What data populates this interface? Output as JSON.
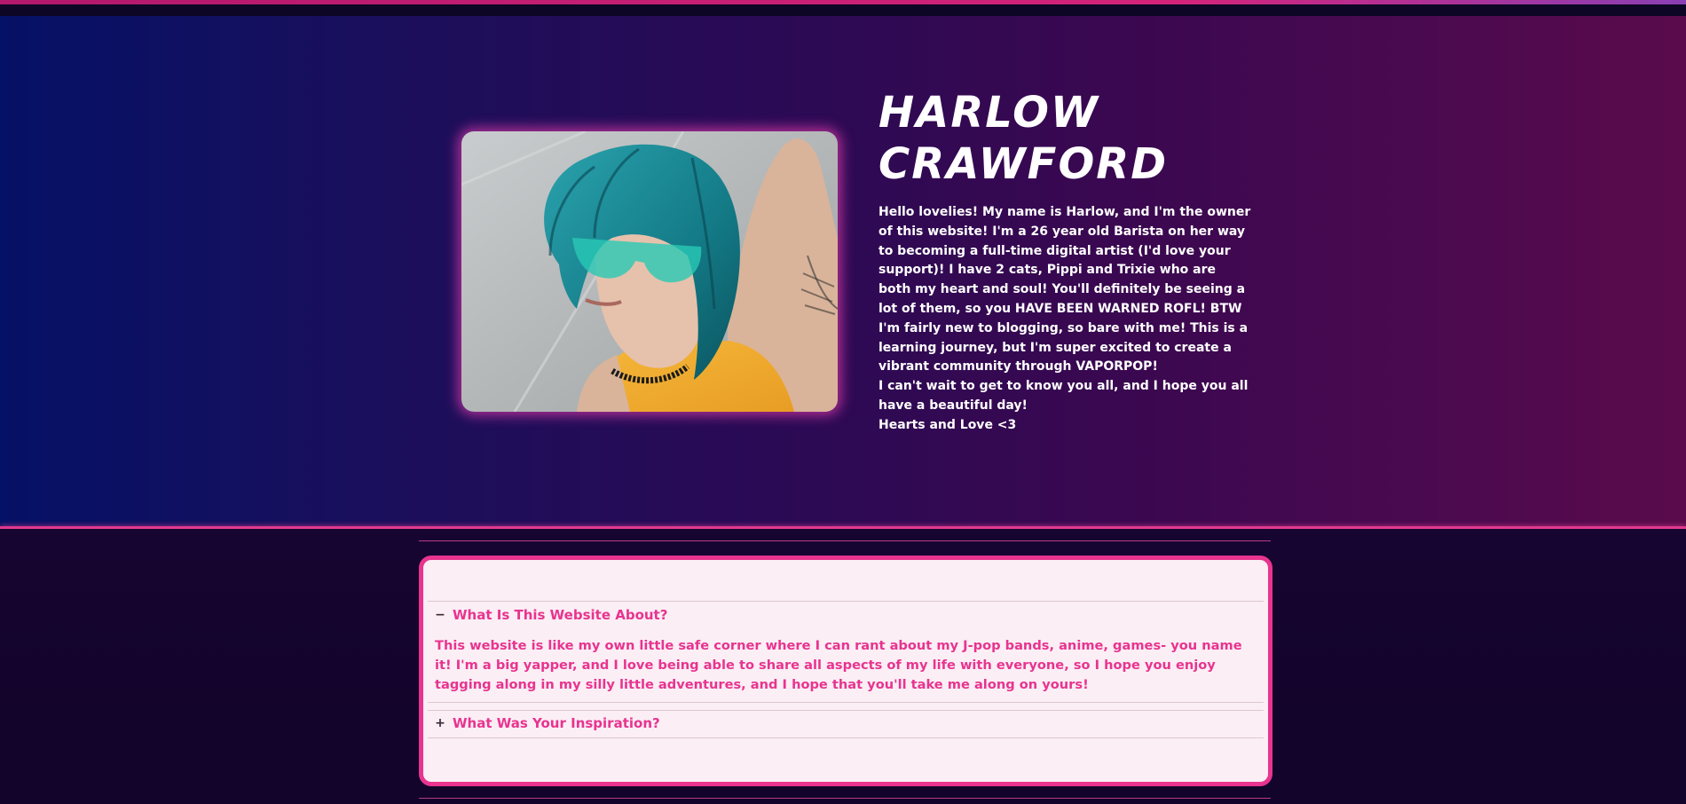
{
  "profile": {
    "name": "HARLOW CRAWFORD",
    "photo_alt": "photo of Harlow with teal hair and tinted sunglasses",
    "bio": [
      "Hello lovelies! My name is Harlow, and I'm the owner of this website! I'm a 26 year old Barista on her way to becoming a full-time digital artist (I'd love your support)! I have 2 cats, Pippi and Trixie who are both my heart and soul! You'll definitely be seeing a lot of them, so you HAVE BEEN WARNED ROFL! BTW",
      "I'm fairly new to blogging, so bare with me! This is a learning journey, but I'm super excited to create a vibrant community through VAPORPOP!",
      "I can't wait to get to know you all, and I hope you all have a beautiful day!",
      "Hearts and Love <3"
    ]
  },
  "faq": {
    "items": [
      {
        "question": "What Is This Website About?",
        "toggle": "−",
        "expanded": true,
        "answer": "This website is like my own little safe corner where I can rant about my J-pop bands, anime, games- you name it! I'm a big yapper, and I love being able to share all aspects of my life with everyone, so I hope you enjoy tagging along in my silly little adventures, and I hope that you'll take me along on yours!"
      },
      {
        "question": "What Was Your Inspiration?",
        "toggle": "+",
        "expanded": false
      }
    ]
  },
  "colors": {
    "accent_pink": "#e8348f",
    "hero_left": "#051166",
    "hero_right": "#5a0b4b",
    "faq_background": "#fbeef5",
    "page_dark": "#12052a"
  }
}
